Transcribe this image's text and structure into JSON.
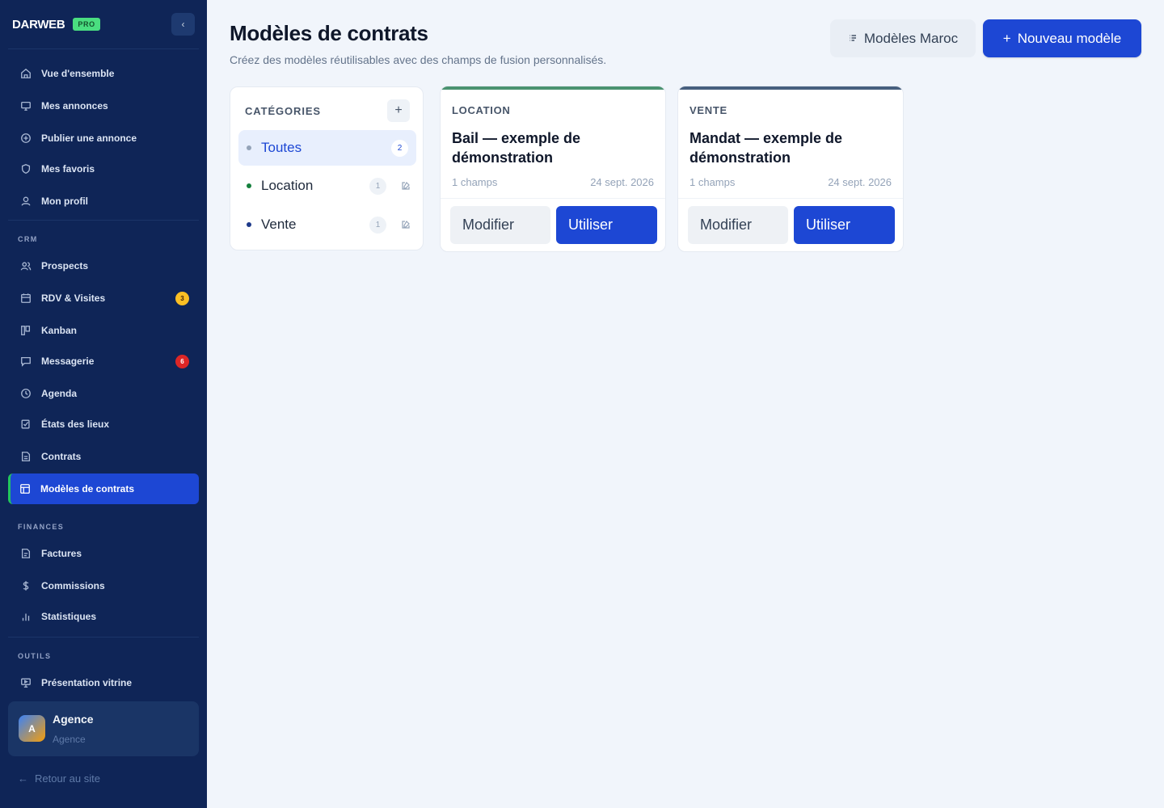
{
  "brand": {
    "name": "DARWEB",
    "badge": "PRO"
  },
  "sidebar": {
    "collapse_icon": "chevron-left-icon",
    "items_main": [
      {
        "label": "Vue d'ensemble",
        "icon": "home-icon"
      },
      {
        "label": "Mes annonces",
        "icon": "monitor-icon"
      },
      {
        "label": "Publier une annonce",
        "icon": "plus-circle-icon"
      },
      {
        "label": "Mes favoris",
        "icon": "shield-heart-icon"
      },
      {
        "label": "Mon profil",
        "icon": "user-icon"
      }
    ],
    "section_crm": "CRM",
    "items_crm": [
      {
        "label": "Prospects",
        "icon": "users-icon"
      },
      {
        "label": "RDV & Visites",
        "icon": "calendar-icon",
        "badge": "3"
      },
      {
        "label": "Kanban",
        "icon": "kanban-icon"
      },
      {
        "label": "Messagerie",
        "icon": "message-icon",
        "badge": "6"
      },
      {
        "label": "Agenda",
        "icon": "clock-icon"
      },
      {
        "label": "États des lieux",
        "icon": "clipboard-check-icon"
      },
      {
        "label": "Contrats",
        "icon": "file-icon"
      },
      {
        "label": "Modèles de contrats",
        "icon": "template-icon",
        "active": true
      }
    ],
    "section_finances": "FINANCES",
    "items_finances": [
      {
        "label": "Factures",
        "icon": "file-text-icon"
      },
      {
        "label": "Commissions",
        "icon": "dollar-icon"
      },
      {
        "label": "Statistiques",
        "icon": "bar-chart-icon"
      }
    ],
    "section_outils": "OUTILS",
    "items_outils": [
      {
        "label": "Présentation vitrine",
        "icon": "presentation-icon"
      }
    ],
    "user": {
      "initial": "A",
      "name": "Agence",
      "role": "Agence"
    },
    "back_link": "Retour au site"
  },
  "header": {
    "title": "Modèles de contrats",
    "subtitle": "Créez des modèles réutilisables avec des champs de fusion personnalisés.",
    "maroc_button": "Modèles Maroc",
    "new_button": "Nouveau modèle"
  },
  "categories": {
    "title": "CATÉGORIES",
    "items": [
      {
        "label": "Toutes",
        "count": "2",
        "dot": "#94a3b8",
        "active": true
      },
      {
        "label": "Location",
        "count": "1",
        "dot": "#15803d"
      },
      {
        "label": "Vente",
        "count": "1",
        "dot": "#1e3a8a"
      }
    ]
  },
  "templates": [
    {
      "category": "LOCATION",
      "name": "Bail — exemple de démonstration",
      "fields": "1 champs",
      "date": "24 sept. 2026",
      "accent": "#4a9270",
      "edit_label": "Modifier",
      "use_label": "Utiliser"
    },
    {
      "category": "VENTE",
      "name": "Mandat — exemple de démonstration",
      "fields": "1 champs",
      "date": "24 sept. 2026",
      "accent": "#475f7e",
      "edit_label": "Modifier",
      "use_label": "Utiliser"
    }
  ],
  "colors": {
    "sidebar_bg": "#0f2557",
    "primary": "#1d47d4",
    "active_marker": "#22c55e",
    "page_bg": "#f1f5fb"
  }
}
